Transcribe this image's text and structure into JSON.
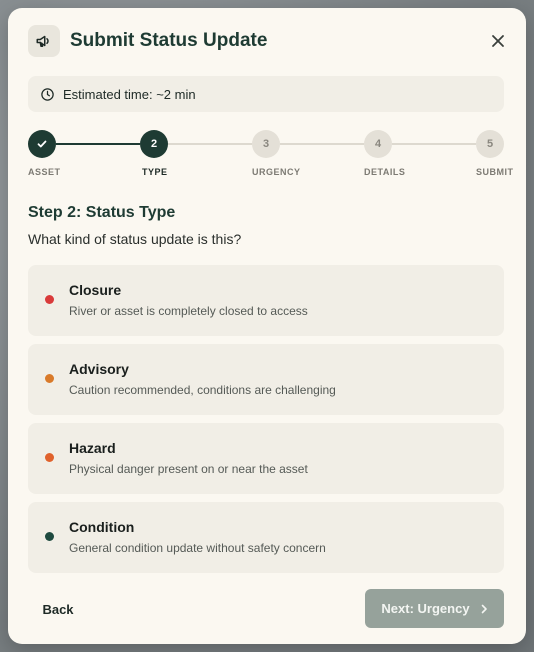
{
  "dialog": {
    "title": "Submit Status Update",
    "estimate": "Estimated time: ~2 min"
  },
  "stepper": {
    "steps": [
      {
        "number": "1",
        "label": "ASSET",
        "state": "done"
      },
      {
        "number": "2",
        "label": "TYPE",
        "state": "active"
      },
      {
        "number": "3",
        "label": "URGENCY",
        "state": "todo"
      },
      {
        "number": "4",
        "label": "DETAILS",
        "state": "todo"
      },
      {
        "number": "5",
        "label": "SUBMIT",
        "state": "todo"
      }
    ]
  },
  "step": {
    "heading": "Step 2: Status Type",
    "question": "What kind of status update is this?"
  },
  "options": [
    {
      "title": "Closure",
      "description": "River or asset is completely closed to access",
      "color": "#d93a3a"
    },
    {
      "title": "Advisory",
      "description": "Caution recommended, conditions are challenging",
      "color": "#d97a2a"
    },
    {
      "title": "Hazard",
      "description": "Physical danger present on or near the asset",
      "color": "#e0622c"
    },
    {
      "title": "Condition",
      "description": "General condition update without safety concern",
      "color": "#1e4a3f"
    }
  ],
  "footer": {
    "back_label": "Back",
    "next_label": "Next: Urgency"
  },
  "icons": {
    "header": "megaphone-icon",
    "close": "close-icon",
    "estimate": "clock-icon",
    "step_done": "check-icon",
    "next": "chevron-right-icon"
  },
  "colors": {
    "primary": "#1e3b33",
    "surface": "#fbf8f1",
    "card": "#f1eee6",
    "next_button": "#96a29b"
  }
}
